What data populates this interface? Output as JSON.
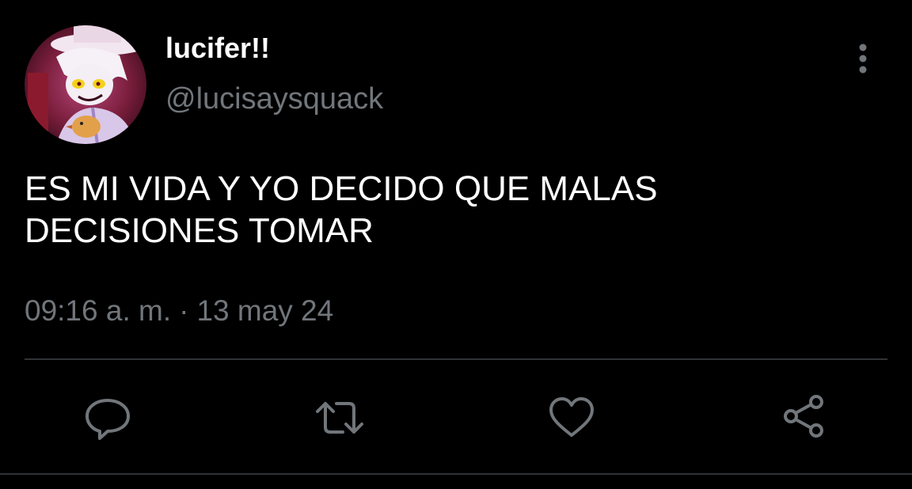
{
  "tweet": {
    "author": {
      "display_name": "lucifer!!",
      "handle": "@lucisaysquack",
      "avatar_icon": "profile-avatar-image"
    },
    "text_lines": [
      "ES MI VIDA Y YO DECIDO QUE MALAS",
      "DECISIONES TOMAR"
    ],
    "time": "09:16 a. m.",
    "separator": "·",
    "date": "13 may 24",
    "more_icon": "more-vertical-icon"
  },
  "actions": {
    "reply_icon": "reply-bubble-icon",
    "retweet_icon": "retweet-icon",
    "like_icon": "heart-icon",
    "share_icon": "share-icon"
  },
  "colors": {
    "background": "#000000",
    "text_primary": "#ffffff",
    "text_secondary": "#71767b",
    "divider": "#2f3336"
  }
}
